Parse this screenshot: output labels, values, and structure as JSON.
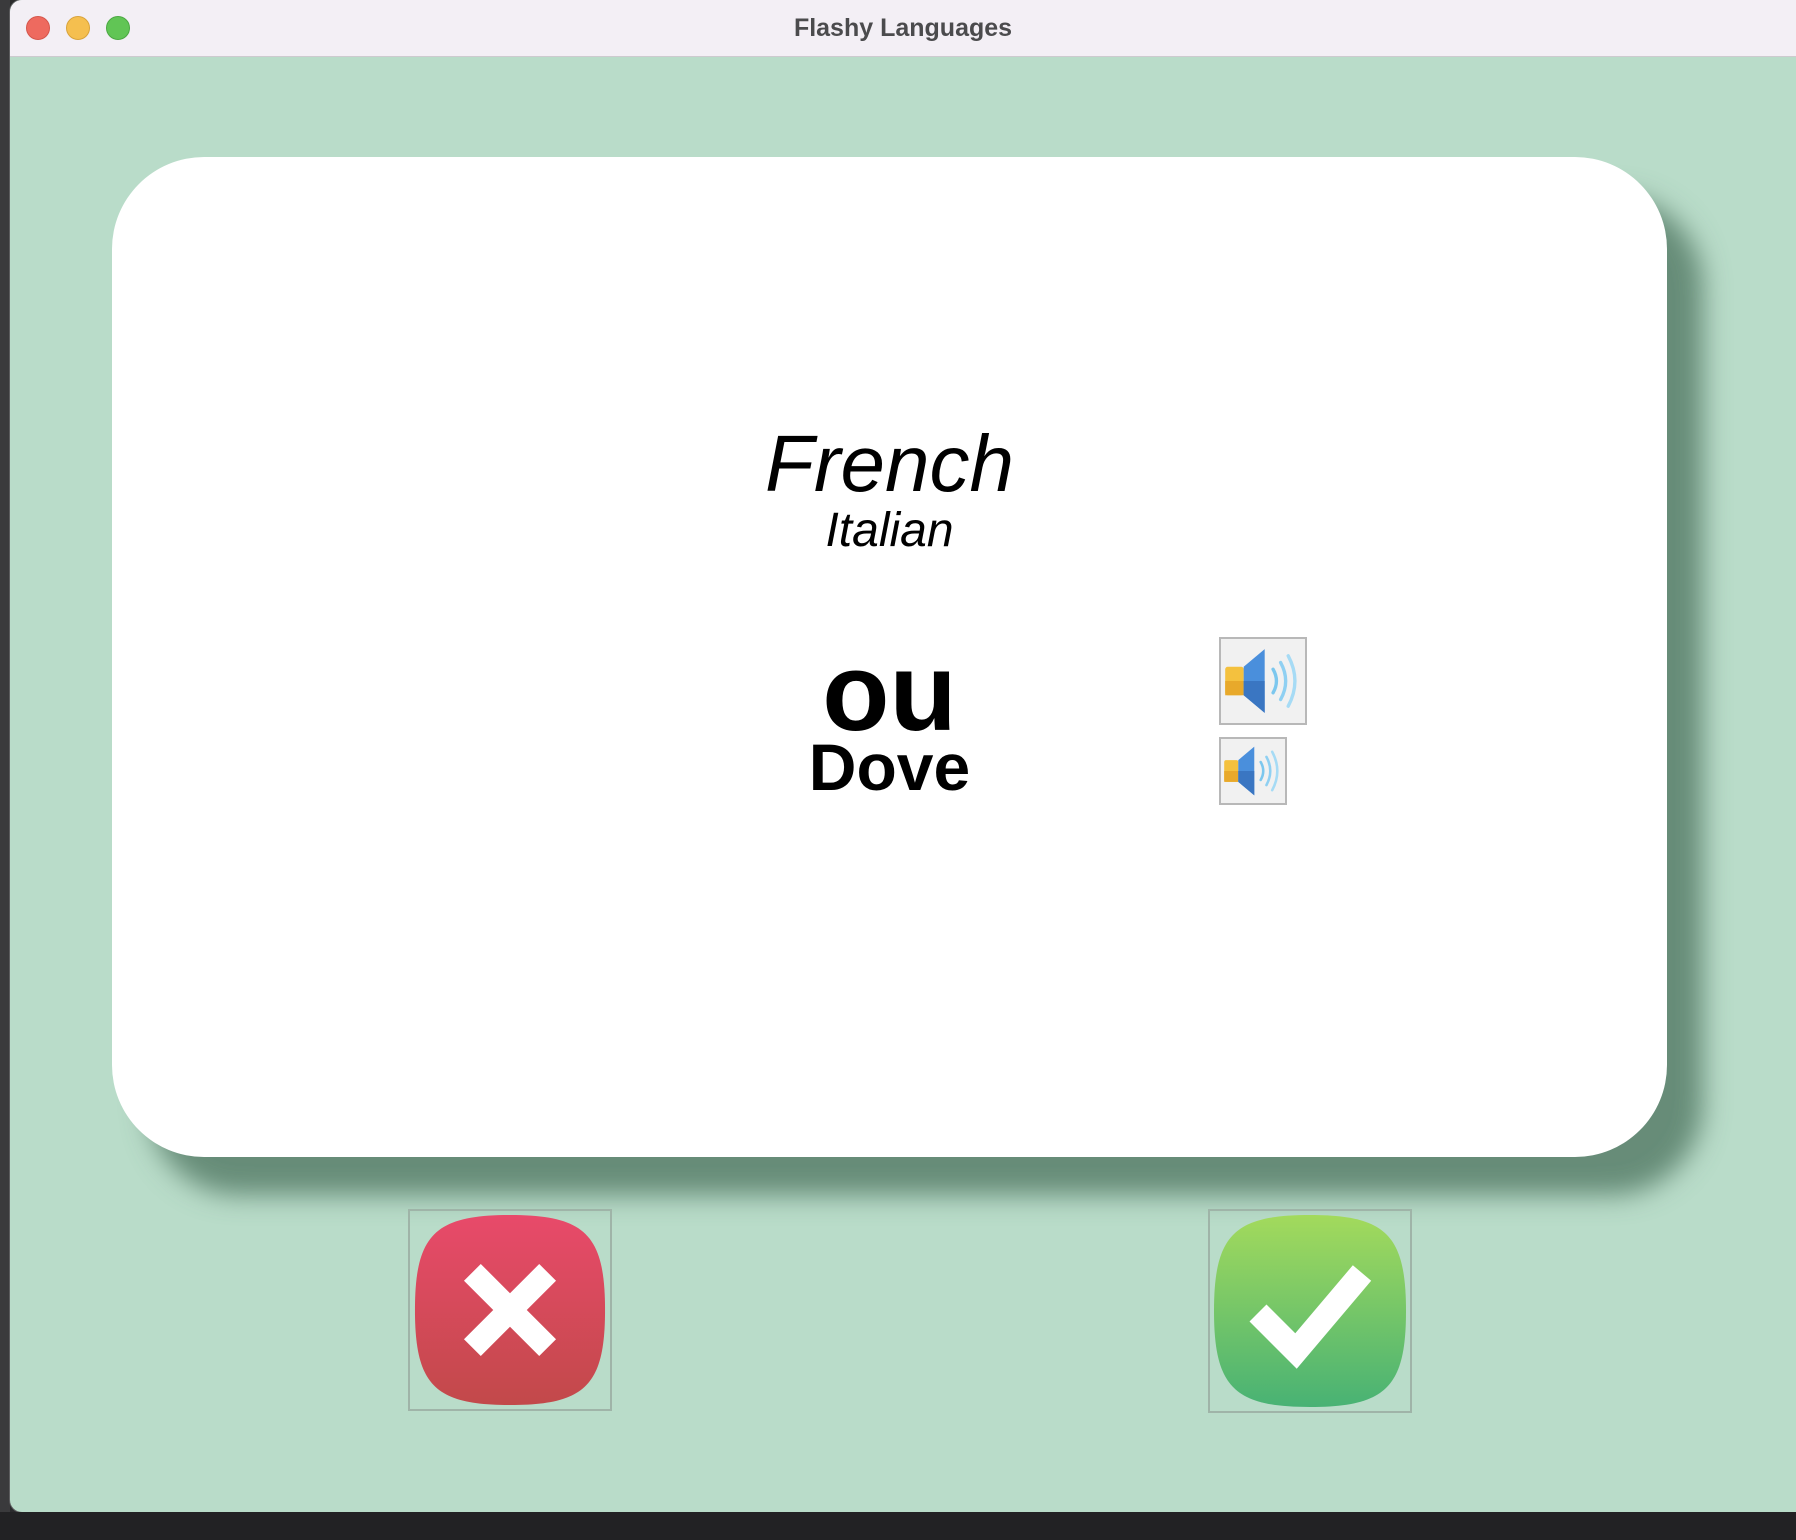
{
  "window": {
    "title": "Flashy Languages"
  },
  "card": {
    "from_language": "French",
    "to_language": "Italian",
    "from_word": "ou",
    "to_word": "Dove"
  },
  "icons": {
    "close": "close-window-icon",
    "minimize": "minimize-window-icon",
    "maximize": "maximize-window-icon",
    "speaker": "speaker-icon",
    "wrong": "cross-icon",
    "right": "check-icon"
  },
  "colors": {
    "background": "#b9dcc9",
    "card": "#ffffff",
    "wrong_top": "#e84a6a",
    "wrong_bottom": "#c2494a",
    "right_top": "#a3da5c",
    "right_bottom": "#48b274"
  }
}
